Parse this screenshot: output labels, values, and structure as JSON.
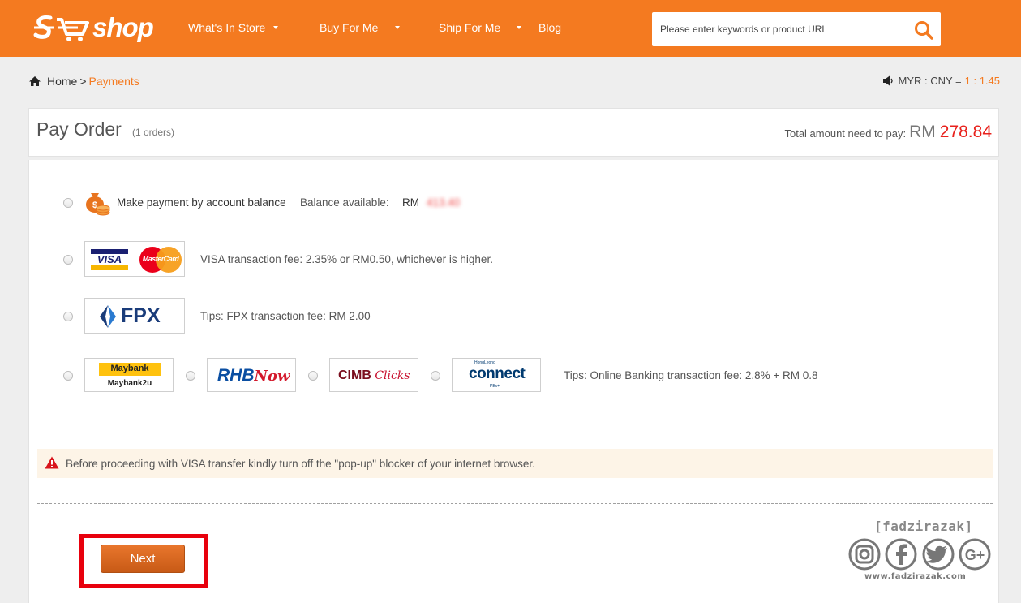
{
  "header": {
    "logo_text": "shop",
    "nav": [
      {
        "label": "What's In Store",
        "has_caret": true
      },
      {
        "label": "Buy For Me",
        "has_caret": true
      },
      {
        "label": "Ship For Me",
        "has_caret": true
      },
      {
        "label": "Blog",
        "has_caret": false
      }
    ],
    "search": {
      "placeholder": "Please enter keywords or product URL",
      "value": ""
    },
    "accent_color": "#f47a20"
  },
  "breadcrumb": {
    "home": "Home",
    "separator": ">",
    "current": "Payments"
  },
  "exchange_rate": {
    "label": "MYR : CNY =",
    "value": "1 : 1.45"
  },
  "order": {
    "title": "Pay Order",
    "count": "(1 orders)",
    "total_label": "Total amount need to pay:",
    "currency": "RM",
    "amount": "278.84",
    "amount_color": "#e8211c"
  },
  "payment_options": {
    "balance": {
      "label": "Make payment by account balance",
      "available_label": "Balance available:",
      "currency": "RM",
      "value": "413.40"
    },
    "visa": {
      "visa_logo": "VISA",
      "mastercard_logo": "MasterCard",
      "note": "VISA transaction fee: 2.35% or RM0.50, whichever is higher."
    },
    "fpx": {
      "logo": "FPX",
      "note": "Tips: FPX transaction fee: RM 2.00"
    },
    "banks": {
      "maybank": {
        "top": "Maybank",
        "bottom": "Maybank2u"
      },
      "rhb": {
        "a": "RHB",
        "b": "Now"
      },
      "cimb": {
        "a": "CIMB",
        "b": "Clicks"
      },
      "hongleong": {
        "top": "HongLeong",
        "main": "connect",
        "sub": "PEx+"
      },
      "note": "Tips: Online Banking transaction fee: 2.8% + RM 0.8"
    }
  },
  "warning": "Before proceeding with VISA transfer kindly turn off the \"pop-up\" blocker of your internet browser.",
  "next_button": "Next",
  "watermark": {
    "name": "[fadzirazak]",
    "url": "www.fadzirazak.com"
  }
}
